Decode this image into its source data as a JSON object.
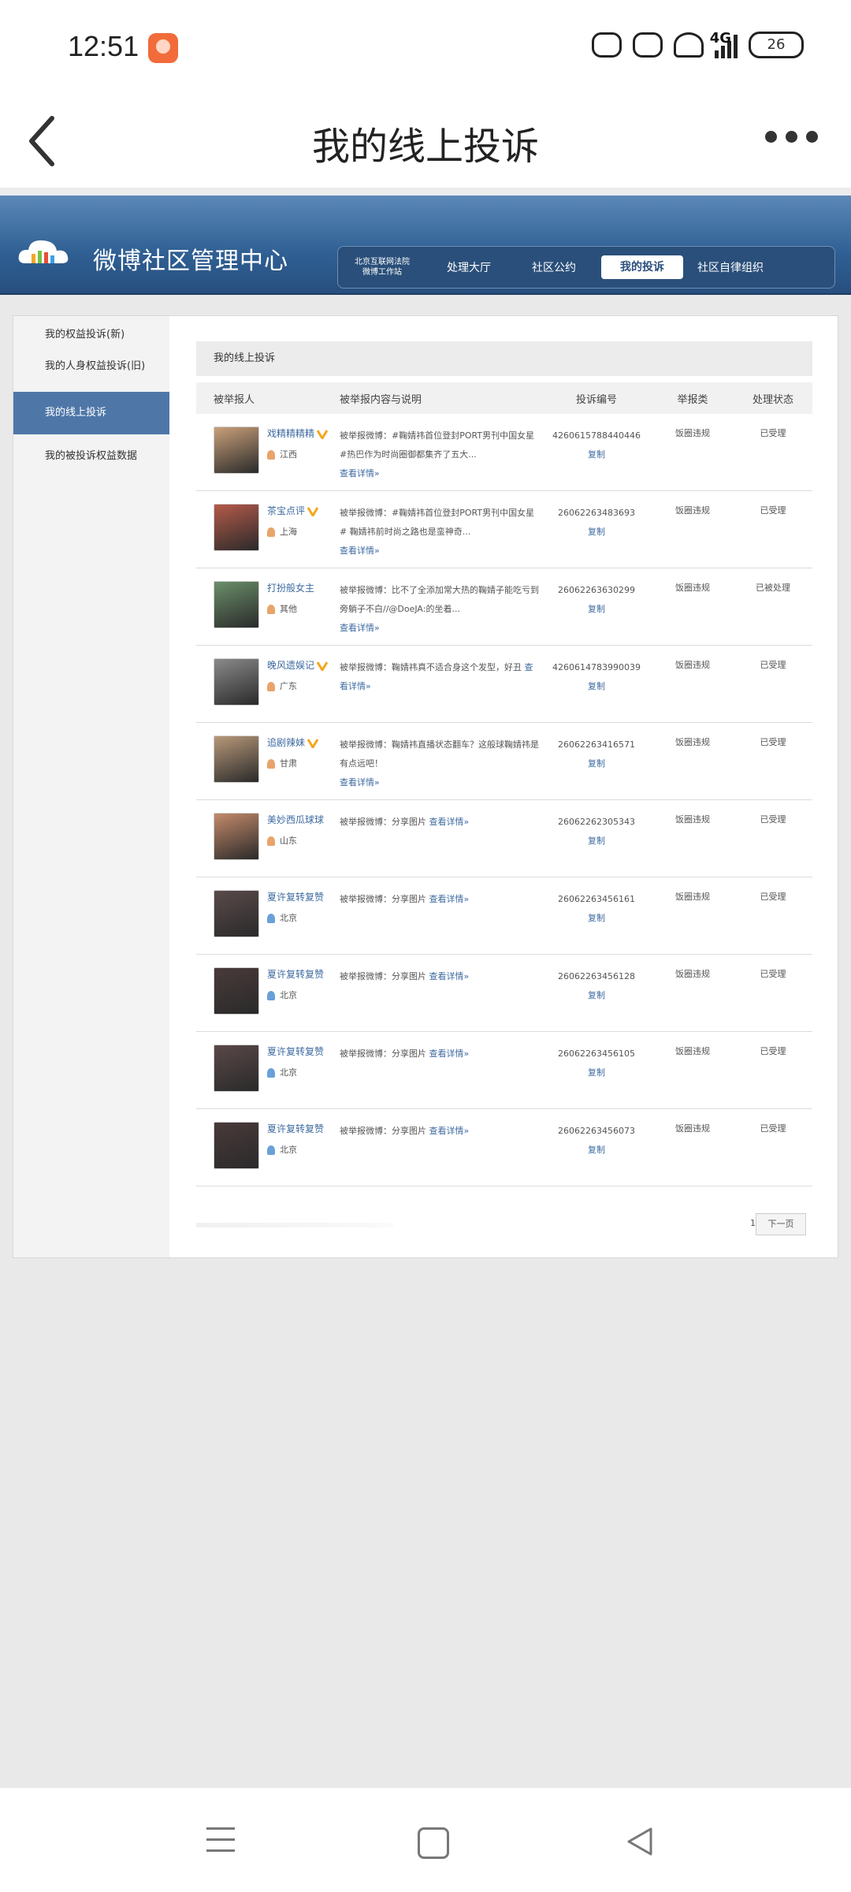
{
  "status_bar": {
    "time": "12:51",
    "network": "4G",
    "battery": "26"
  },
  "header": {
    "title": "我的线上投诉"
  },
  "site": {
    "title": "微博社区管理中心",
    "nav": [
      {
        "label": "北京互联网法院\n微博工作站"
      },
      {
        "label": "处理大厅"
      },
      {
        "label": "社区公约"
      },
      {
        "label": "我的投诉"
      },
      {
        "label": "社区自律组织"
      }
    ]
  },
  "sidebar": {
    "items": [
      {
        "label": "我的权益投诉(新)"
      },
      {
        "label": "我的人身权益投诉(旧)"
      },
      {
        "label": "我的线上投诉"
      },
      {
        "label": "我的被投诉权益数据"
      }
    ]
  },
  "content": {
    "heading": "我的线上投诉",
    "columns": [
      "被举报人",
      "被举报内容与说明",
      "投诉编号",
      "举报类",
      "处理状态"
    ],
    "detail_link": "查看详情»",
    "copy_link": "复制",
    "rows": [
      {
        "name": "戏精精精精",
        "loc": "江西",
        "text": "被举报微博：#鞠婧祎首位登封PORT男刊中国女星#热巴作为时尚圈御都集齐了五大...",
        "id": "4260615788440446",
        "type": "饭圈违规",
        "status": "已受理"
      },
      {
        "name": "茶宝点评",
        "loc": "上海",
        "text": "被举报微博：#鞠婧祎首位登封PORT男刊中国女星# 鞠婧祎前时尚之路也是蛮神奇...",
        "id": "26062263483693",
        "type": "饭圈违规",
        "status": "已受理"
      },
      {
        "name": "打扮般女主",
        "loc": "其他",
        "text": "被举报微博：比不了全添加常大热的鞠婧子能吃亏到旁躺子不白//@DoeJA:的坐着...",
        "id": "26062263630299",
        "type": "饭圈违规",
        "status": "已被处理"
      },
      {
        "name": "晚风遗娱记",
        "loc": "广东",
        "text": "被举报微博：鞠婧祎真不适合身这个发型，好丑",
        "id": "4260614783990039",
        "type": "饭圈违规",
        "status": "已受理"
      },
      {
        "name": "追剧辣妹",
        "loc": "甘肃",
        "text": "被举报微博：鞠婧祎直播状态翻车？这般球鞠婧祎是有点远吧！",
        "id": "26062263416571",
        "type": "饭圈违规",
        "status": "已受理"
      },
      {
        "name": "美妙西瓜球球",
        "loc": "山东",
        "text": "被举报微博：分享图片",
        "id": "26062262305343",
        "type": "饭圈违规",
        "status": "已受理"
      },
      {
        "name": "夏许复转复赞",
        "loc": "北京",
        "text": "被举报微博：分享图片",
        "id": "26062263456161",
        "type": "饭圈违规",
        "status": "已受理"
      },
      {
        "name": "夏许复转复赞",
        "loc": "北京",
        "text": "被举报微博：分享图片",
        "id": "26062263456128",
        "type": "饭圈违规",
        "status": "已受理"
      },
      {
        "name": "夏许复转复赞",
        "loc": "北京",
        "text": "被举报微博：分享图片",
        "id": "26062263456105",
        "type": "饭圈违规",
        "status": "已受理"
      },
      {
        "name": "夏许复转复赞",
        "loc": "北京",
        "text": "被举报微博：分享图片",
        "id": "26062263456073",
        "type": "饭圈违规",
        "status": "已受理"
      }
    ],
    "pager": {
      "page": "1",
      "next": "下一页"
    }
  }
}
